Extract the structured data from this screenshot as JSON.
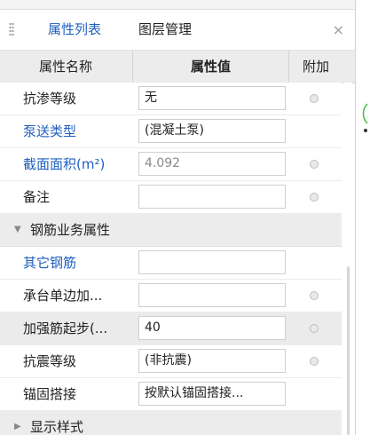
{
  "tabs": {
    "properties_label": "属性列表",
    "layers_label": "图层管理",
    "close_symbol": "×"
  },
  "table": {
    "col_name": "属性名称",
    "col_value": "属性值",
    "col_extra": "附加"
  },
  "rows": {
    "r0": {
      "label": "抗渗等级",
      "value": "无"
    },
    "r1": {
      "label": "泵送类型",
      "value": "(混凝土泵)"
    },
    "r2": {
      "label": "截面面积(m²)",
      "value": "4.092"
    },
    "r3": {
      "label": "备注",
      "value": ""
    },
    "group1": {
      "label": "钢筋业务属性"
    },
    "r4": {
      "label": "其它钢筋",
      "value": ""
    },
    "r5": {
      "label": "承台单边加...",
      "value": ""
    },
    "r6": {
      "label": "加强筋起步(...",
      "value": "40"
    },
    "r7": {
      "label": "抗震等级",
      "value": "(非抗震)"
    },
    "r8": {
      "label": "锚固搭接",
      "value": "按默认锚固搭接..."
    },
    "group2": {
      "label": "显示样式"
    }
  },
  "colors": {
    "accent_blue": "#1f5fbf",
    "highlight_row": "#ebebeb"
  }
}
